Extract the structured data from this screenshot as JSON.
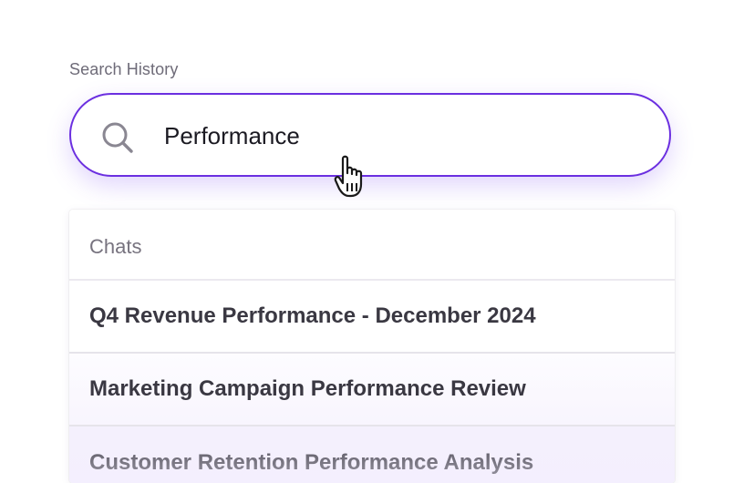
{
  "search": {
    "label": "Search History",
    "value": "Performance",
    "icon": "search-icon"
  },
  "results": {
    "header": "Chats",
    "items": [
      {
        "title": "Q4 Revenue Performance - December 2024"
      },
      {
        "title": "Marketing Campaign Performance Review"
      },
      {
        "title": "Customer Retention Performance Analysis"
      }
    ]
  },
  "colors": {
    "accent": "#6b2fe0",
    "text": "#3a3842",
    "muted": "#77737f"
  }
}
